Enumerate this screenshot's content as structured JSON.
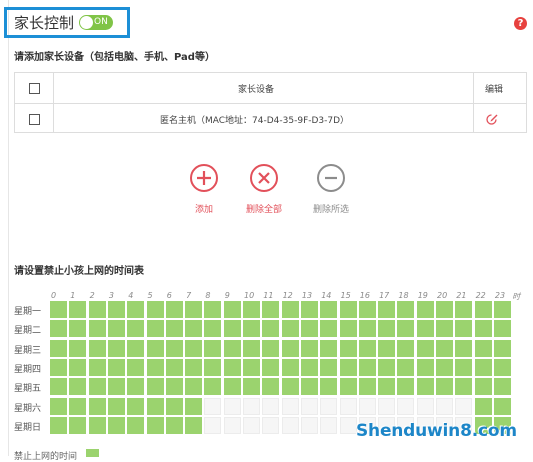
{
  "header": {
    "title": "家长控制",
    "toggle_label": "ON",
    "help_symbol": "?"
  },
  "devices": {
    "section_label": "请添加家长设备（包括电脑、手机、Pad等）",
    "columns": [
      "家长设备",
      "编辑"
    ],
    "rows": [
      {
        "name": "匿名主机（MAC地址：74-D4-35-9F-D3-7D）",
        "edit_icon": "edit-icon"
      }
    ]
  },
  "actions": [
    {
      "label": "添加",
      "icon": "plus-icon",
      "color": "#e2505a"
    },
    {
      "label": "删除全部",
      "icon": "x-icon",
      "color": "#e2505a"
    },
    {
      "label": "删除所选",
      "icon": "minus-icon",
      "color": "#8c8c8c"
    }
  ],
  "schedule": {
    "section_label": "请设置禁止小孩上网的时间表",
    "hours": [
      "0",
      "1",
      "2",
      "3",
      "4",
      "5",
      "6",
      "7",
      "8",
      "9",
      "10",
      "11",
      "12",
      "13",
      "14",
      "15",
      "16",
      "17",
      "18",
      "19",
      "20",
      "21",
      "22",
      "23"
    ],
    "hour_unit": "时",
    "days": [
      {
        "label": "星期一",
        "blocked": [
          0,
          1,
          2,
          3,
          4,
          5,
          6,
          7,
          8,
          9,
          10,
          11,
          12,
          13,
          14,
          15,
          16,
          17,
          18,
          19,
          20,
          21,
          22,
          23
        ]
      },
      {
        "label": "星期二",
        "blocked": [
          0,
          1,
          2,
          3,
          4,
          5,
          6,
          7,
          8,
          9,
          10,
          11,
          12,
          13,
          14,
          15,
          16,
          17,
          18,
          19,
          20,
          21,
          22,
          23
        ]
      },
      {
        "label": "星期三",
        "blocked": [
          0,
          1,
          2,
          3,
          4,
          5,
          6,
          7,
          8,
          9,
          10,
          11,
          12,
          13,
          14,
          15,
          16,
          17,
          18,
          19,
          20,
          21,
          22,
          23
        ]
      },
      {
        "label": "星期四",
        "blocked": [
          0,
          1,
          2,
          3,
          4,
          5,
          6,
          7,
          8,
          9,
          10,
          11,
          12,
          13,
          14,
          15,
          16,
          17,
          18,
          19,
          20,
          21,
          22,
          23
        ]
      },
      {
        "label": "星期五",
        "blocked": [
          0,
          1,
          2,
          3,
          4,
          5,
          6,
          7,
          8,
          9,
          10,
          11,
          12,
          13,
          14,
          15,
          16,
          17,
          18,
          19,
          20,
          21,
          22,
          23
        ]
      },
      {
        "label": "星期六",
        "blocked": [
          0,
          1,
          2,
          3,
          4,
          5,
          6,
          7,
          22,
          23
        ]
      },
      {
        "label": "星期日",
        "blocked": [
          0,
          1,
          2,
          3,
          4,
          5,
          6,
          7,
          22,
          23
        ]
      }
    ],
    "legend_label": "禁止上网的时间",
    "on_color": "#9bd36e",
    "off_color": "#f6f6f6"
  },
  "watermark": "Shenduwin8.com"
}
